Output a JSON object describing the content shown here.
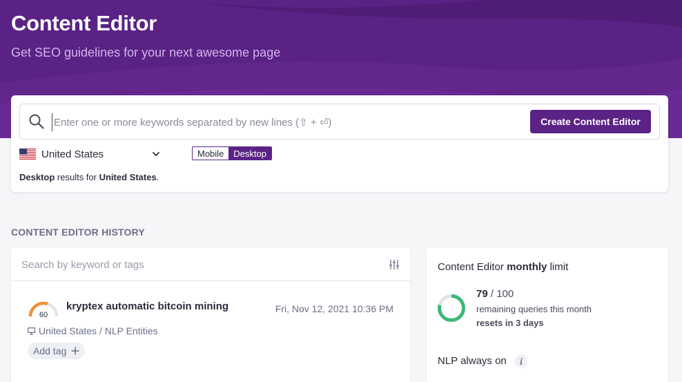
{
  "hero": {
    "title": "Content Editor",
    "subtitle": "Get SEO guidelines for your next awesome page"
  },
  "search": {
    "placeholder": "Enter one or more keywords separated by new lines (⇧ + ⏎)",
    "value": "",
    "create_button": "Create Content Editor",
    "country": "United States",
    "country_icon": "us-flag-icon",
    "device_options": [
      "Mobile",
      "Desktop"
    ],
    "device_selected": "Desktop",
    "results_note": {
      "device": "Desktop",
      "middle": " results for ",
      "country": "United States",
      "end": "."
    }
  },
  "history": {
    "heading": "CONTENT EDITOR HISTORY",
    "search_placeholder": "Search by keyword or tags",
    "entries": [
      {
        "score": "60",
        "score_value": 60,
        "title": "kryptex automatic bitcoin mining",
        "date": "Fri, Nov 12, 2021 10:36 PM",
        "meta": "United States / NLP Entities",
        "add_tag": "Add tag"
      }
    ]
  },
  "limit": {
    "title_prefix": "Content Editor ",
    "title_bold": "monthly",
    "title_suffix": " limit",
    "used": "79",
    "separator": " / ",
    "total": "100",
    "fraction_remaining": 0.79,
    "remaining_text": "remaining queries this month",
    "resets_text": "resets in 3 days",
    "nlp_label": "NLP always on"
  },
  "colors": {
    "brand": "#5b2385",
    "gauge_orange": "#f0913a",
    "ring_green": "#3cb878"
  }
}
